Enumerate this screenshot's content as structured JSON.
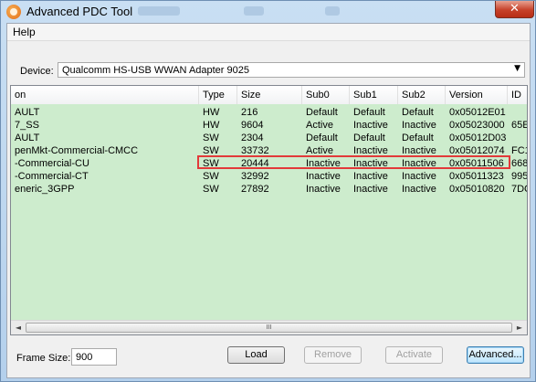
{
  "window": {
    "title": "Advanced PDC Tool",
    "close_symbol": "✕"
  },
  "menu": {
    "help": "Help"
  },
  "device": {
    "label": "Device:",
    "value": "Qualcomm HS-USB WWAN Adapter 9025",
    "arrow": "▼"
  },
  "table": {
    "columns": [
      "on",
      "Type",
      "Size",
      "Sub0",
      "Sub1",
      "Sub2",
      "Version",
      "ID"
    ],
    "rows": [
      [
        "AULT",
        "HW",
        "216",
        "Default",
        "Default",
        "Default",
        "0x05012E01",
        ""
      ],
      [
        "7_SS",
        "HW",
        "9604",
        "Active",
        "Inactive",
        "Inactive",
        "0x05023000",
        "65E"
      ],
      [
        "AULT",
        "SW",
        "2304",
        "Default",
        "Default",
        "Default",
        "0x05012D03",
        ""
      ],
      [
        "penMkt-Commercial-CMCC",
        "SW",
        "33732",
        "Active",
        "Inactive",
        "Inactive",
        "0x05012074",
        "FC1"
      ],
      [
        "-Commercial-CU",
        "SW",
        "20444",
        "Inactive",
        "Inactive",
        "Inactive",
        "0x05011506",
        "668"
      ],
      [
        "-Commercial-CT",
        "SW",
        "32992",
        "Inactive",
        "Inactive",
        "Inactive",
        "0x05011323",
        "995"
      ],
      [
        "eneric_3GPP",
        "SW",
        "27892",
        "Inactive",
        "Inactive",
        "Inactive",
        "0x05010820",
        "7DC"
      ]
    ],
    "highlighted_row_index": 3,
    "highlight_color": "#e23a3a",
    "row_bg_color": "#cdeccd"
  },
  "scrollbar": {
    "left_arrow": "◄",
    "right_arrow": "►",
    "grip": "III"
  },
  "frame_size": {
    "label": "Frame Size:",
    "value": "900"
  },
  "buttons": {
    "load": "Load",
    "remove": "Remove",
    "activate": "Activate",
    "advanced": "Advanced..."
  }
}
